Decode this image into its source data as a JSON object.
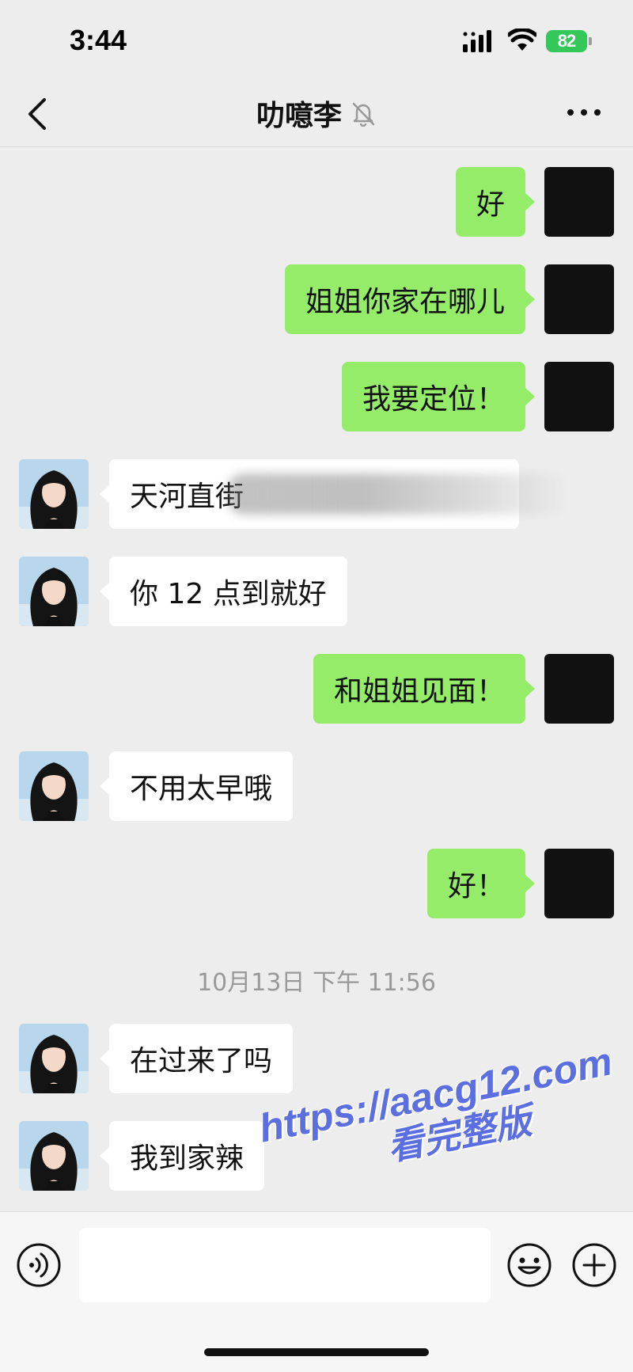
{
  "status_bar": {
    "time": "3:44",
    "battery_level": "82",
    "icons": [
      "cellular-signal-icon",
      "wifi-icon",
      "battery-charging-icon"
    ]
  },
  "nav": {
    "title": "叻噫李",
    "back_icon": "chevron-left-icon",
    "mute_icon": "bell-slash-icon",
    "more_icon": "ellipsis-icon"
  },
  "messages": [
    {
      "side": "self",
      "text": "好"
    },
    {
      "side": "self",
      "text": "姐姐你家在哪儿"
    },
    {
      "side": "self",
      "text": "我要定位！"
    },
    {
      "side": "other",
      "text": "天河直街",
      "note_blurred": true
    },
    {
      "side": "other",
      "text": "你 12 点到就好"
    },
    {
      "side": "self",
      "text": "和姐姐见面！"
    },
    {
      "side": "other",
      "text": "不用太早哦"
    },
    {
      "side": "self",
      "text": "好！"
    },
    {
      "side": "other",
      "text": "在过来了吗"
    },
    {
      "side": "other",
      "text": "我到家辣"
    }
  ],
  "timestamp": "10月13日 下午 11:56",
  "input_bar": {
    "value": "",
    "icons": [
      "voice-icon",
      "emoji-icon",
      "plus-icon"
    ]
  },
  "watermark": {
    "url": "https://aacg12.com",
    "subtitle": "看完整版"
  },
  "colors": {
    "background": "#ededed",
    "self_bubble": "#95ec69",
    "other_bubble": "#ffffff",
    "battery": "#34c759",
    "watermark": "#5b6fe0"
  }
}
